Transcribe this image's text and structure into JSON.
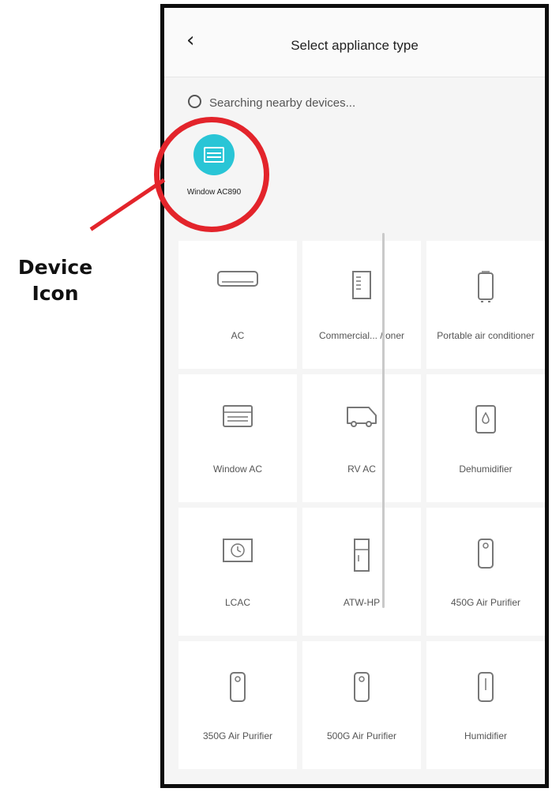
{
  "header": {
    "title": "Select appliance type",
    "back_icon": "chevron-left-icon"
  },
  "search": {
    "status": "Searching nearby devices..."
  },
  "found_device": {
    "label": "Window AC890",
    "icon": "window-ac-icon",
    "color": "#29c5d6"
  },
  "appliances": [
    {
      "label": "AC",
      "icon": "split-ac-icon"
    },
    {
      "label": "Commercial... / oner",
      "icon": "commercial-ac-icon"
    },
    {
      "label": "Portable air conditioner",
      "icon": "portable-ac-icon"
    },
    {
      "label": "Window AC",
      "icon": "window-ac-icon"
    },
    {
      "label": "RV AC",
      "icon": "rv-ac-icon"
    },
    {
      "label": "Dehumidifier",
      "icon": "dehumidifier-icon"
    },
    {
      "label": "LCAC",
      "icon": "lcac-icon"
    },
    {
      "label": "ATW-HP",
      "icon": "heat-pump-icon"
    },
    {
      "label": "450G Air Purifier",
      "icon": "air-purifier-icon"
    },
    {
      "label": "350G Air Purifier",
      "icon": "air-purifier-icon"
    },
    {
      "label": "500G Air Purifier",
      "icon": "air-purifier-icon"
    },
    {
      "label": "Humidifier",
      "icon": "humidifier-icon"
    }
  ],
  "annotation": {
    "line1": "Device",
    "line2": "Icon",
    "color": "#e3242b"
  }
}
